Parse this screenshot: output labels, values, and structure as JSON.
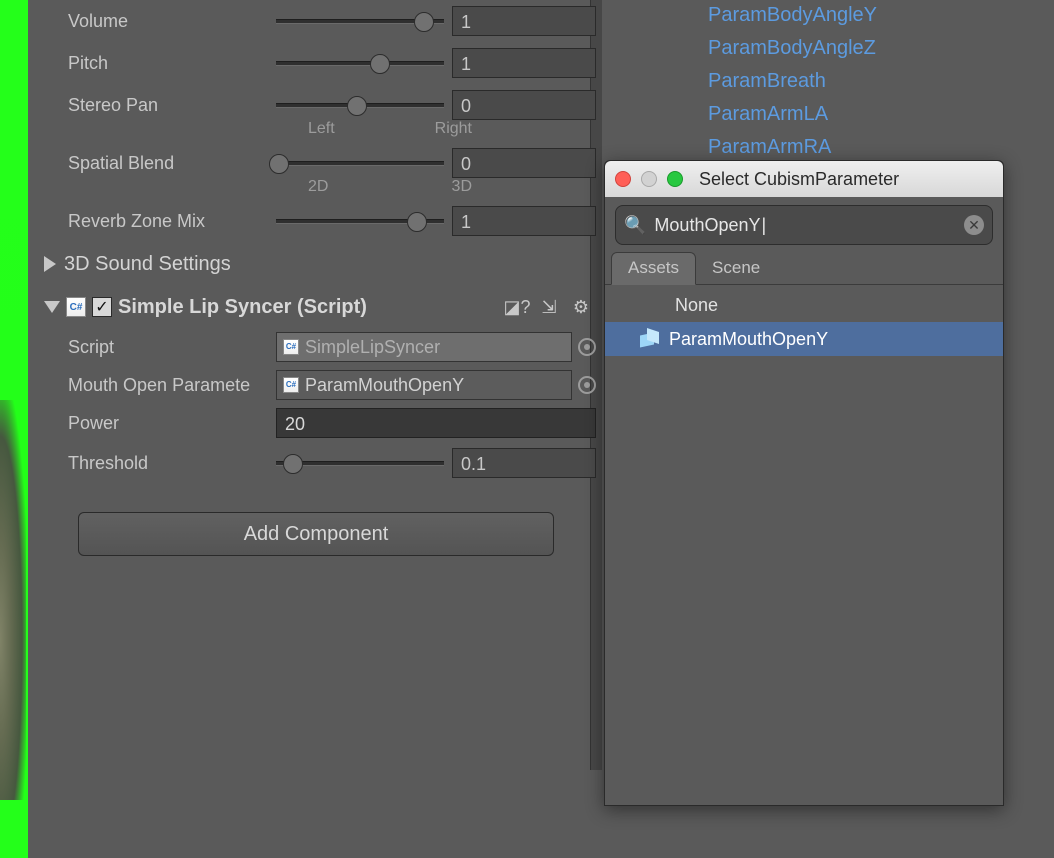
{
  "audio": {
    "volume": {
      "label": "Volume",
      "value": "1",
      "pos": 0.88
    },
    "pitch": {
      "label": "Pitch",
      "value": "1",
      "pos": 0.62
    },
    "stereo": {
      "label": "Stereo Pan",
      "value": "0",
      "pos": 0.48,
      "left": "Left",
      "right": "Right"
    },
    "spatial": {
      "label": "Spatial Blend",
      "value": "0",
      "pos": 0.02,
      "left": "2D",
      "right": "3D"
    },
    "reverb": {
      "label": "Reverb Zone Mix",
      "value": "1",
      "pos": 0.84
    }
  },
  "sound_settings_heading": "3D Sound Settings",
  "component": {
    "title": "Simple Lip Syncer (Script)",
    "script_label": "Script",
    "script_value": "SimpleLipSyncer",
    "mouth_label": "Mouth Open Paramete",
    "mouth_value": "ParamMouthOpenY",
    "power_label": "Power",
    "power_value": "20",
    "threshold_label": "Threshold",
    "threshold_value": "0.1",
    "threshold_pos": 0.1
  },
  "add_component_label": "Add Component",
  "param_links": [
    "ParamBodyAngleY",
    "ParamBodyAngleZ",
    "ParamBreath",
    "ParamArmLA",
    "ParamArmRA"
  ],
  "popup": {
    "title": "Select CubismParameter",
    "search": "MouthOpenY",
    "tabs": {
      "assets": "Assets",
      "scene": "Scene"
    },
    "none_label": "None",
    "result": "ParamMouthOpenY"
  },
  "icons": {
    "cs": "C#"
  }
}
